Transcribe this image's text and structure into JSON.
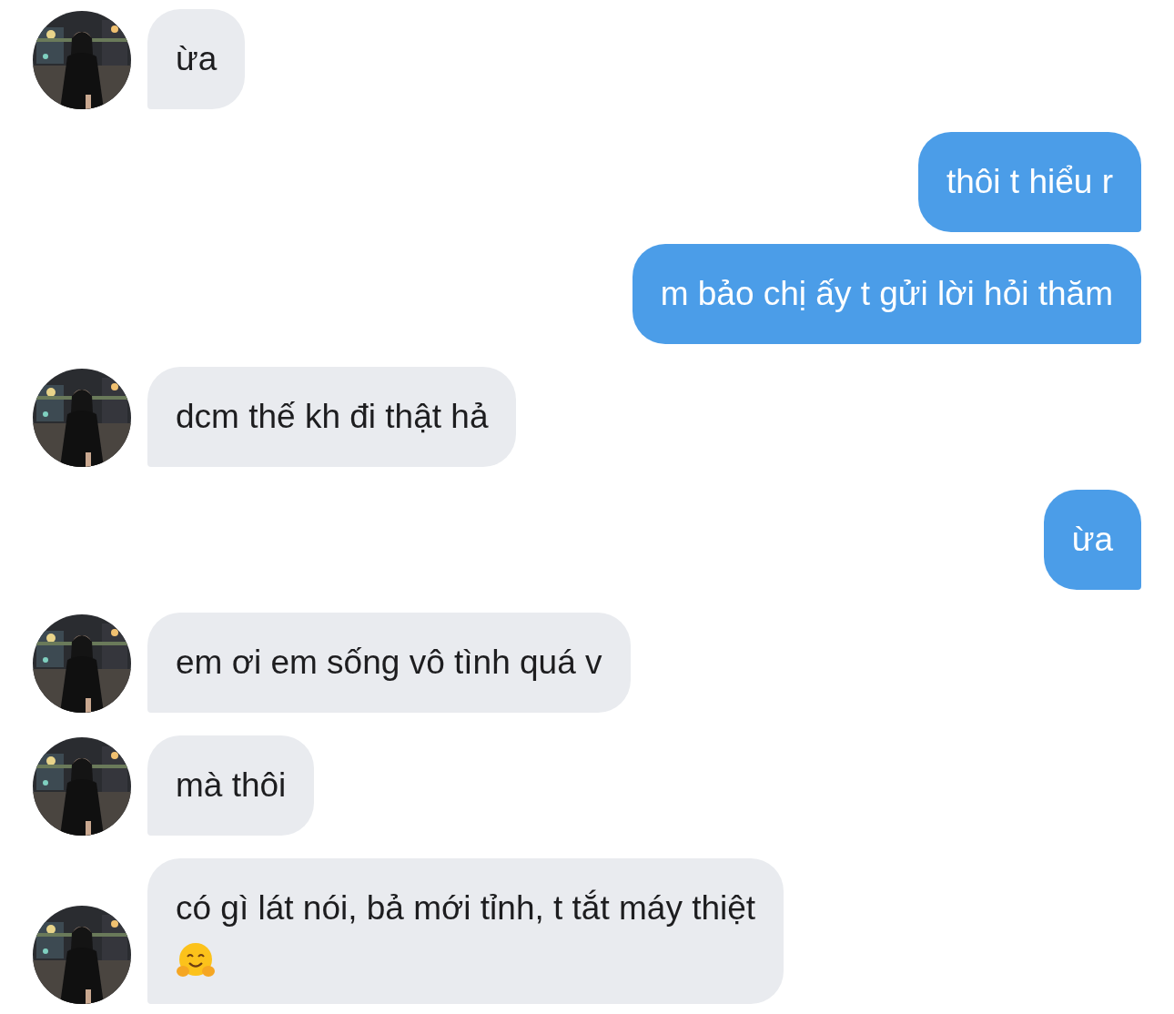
{
  "messages": [
    {
      "kind": "incoming",
      "text": "ừa",
      "trailing_icon": false
    },
    {
      "kind": "outgoing",
      "text": "thôi t hiểu r",
      "trailing_icon": false
    },
    {
      "kind": "outgoing",
      "text": "m bảo chị ấy t gửi lời hỏi thăm",
      "trailing_icon": false
    },
    {
      "kind": "incoming",
      "text": "dcm thế kh đi thật hả",
      "trailing_icon": false
    },
    {
      "kind": "outgoing",
      "text": "ừa",
      "trailing_icon": false
    },
    {
      "kind": "incoming",
      "text": "em ơi em sống vô tình quá v",
      "trailing_icon": false
    },
    {
      "kind": "incoming",
      "text": "mà thôi",
      "trailing_icon": false
    },
    {
      "kind": "incoming",
      "text": "có gì lát nói, bả mới tỉnh, t tắt máy thiệt",
      "trailing_icon": true
    }
  ]
}
